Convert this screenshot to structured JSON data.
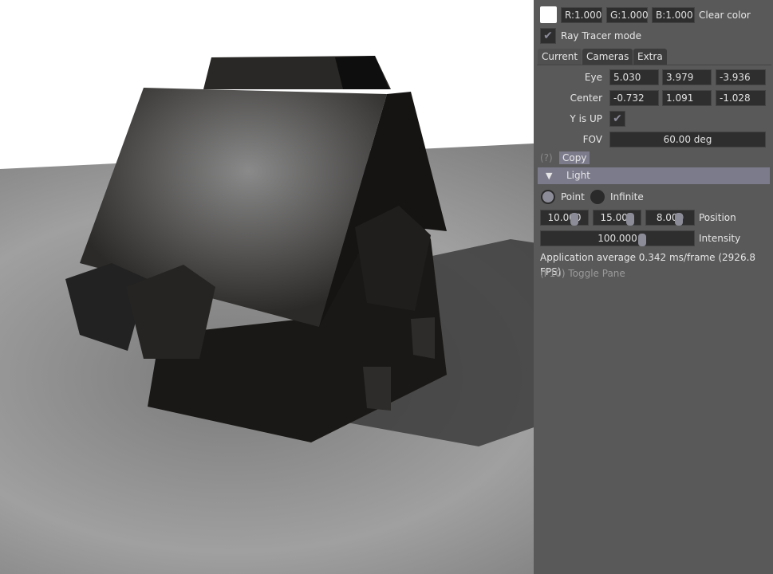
{
  "clear_color": {
    "swatch": "#ffffff",
    "r": "R:1.000",
    "g": "G:1.000",
    "b": "B:1.000",
    "label": "Clear color"
  },
  "ray_tracer": {
    "label": "Ray Tracer mode",
    "checked": true
  },
  "tabs": [
    {
      "label": "Current",
      "active": true
    },
    {
      "label": "Cameras",
      "active": false
    },
    {
      "label": "Extra",
      "active": false
    }
  ],
  "camera": {
    "eye_label": "Eye",
    "eye": [
      "5.030",
      "3.979",
      "-3.936"
    ],
    "center_label": "Center",
    "center": [
      "-0.732",
      "1.091",
      "-1.028"
    ],
    "yup_label": "Y is UP",
    "yup": true,
    "fov_label": "FOV",
    "fov": "60.00 deg"
  },
  "help": "(?)",
  "copy_label": "Copy",
  "light": {
    "header": "Light",
    "point_label": "Point",
    "infinite_label": "Infinite",
    "selected": "Point",
    "position": [
      "10.000",
      "15.000",
      "8.000"
    ],
    "position_label": "Position",
    "intensity": "100.000",
    "intensity_label": "Intensity"
  },
  "stats": "Application average 0.342 ms/frame (2926.8 FPS)",
  "toggle_hint": "(F10) Toggle Pane",
  "colors": {
    "panel": "#595959",
    "field": "#2e2e2e",
    "accent": "#8c8c98",
    "header": "#7c7b8c"
  }
}
